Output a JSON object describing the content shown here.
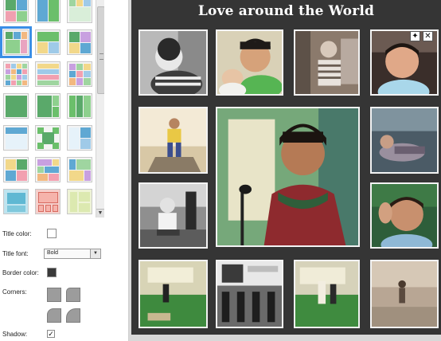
{
  "layout_picker": {
    "selected_index": 3,
    "options": [
      "layout-grid-2x2",
      "layout-split-columns",
      "layout-mosaic-a",
      "layout-grid-3x3",
      "layout-wide-top",
      "layout-mosaic-b",
      "layout-grid-4x4",
      "layout-strips",
      "layout-grid-3x3-b",
      "layout-single-large",
      "layout-large-side",
      "layout-three-up",
      "layout-banner",
      "layout-center-large",
      "layout-panels",
      "layout-checker",
      "layout-bricks",
      "layout-mixed",
      "layout-frame-a",
      "layout-frame-b",
      "layout-frame-c"
    ]
  },
  "options": {
    "title_color_label": "Title color:",
    "title_color": "#ffffff",
    "title_font_label": "Title font:",
    "title_font_value": "Bold",
    "border_color_label": "Border color:",
    "border_color": "#3a3a3a",
    "corners_label": "Corners:",
    "shadow_label": "Shadow:",
    "shadow_checked": true
  },
  "collage": {
    "title": "Love around the World",
    "background": "#353535"
  },
  "icons": {
    "edit": "wand-icon",
    "close": "close-icon"
  }
}
